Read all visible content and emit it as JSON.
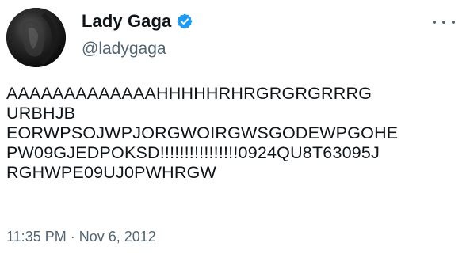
{
  "user": {
    "display_name": "Lady Gaga",
    "handle": "@ladygaga",
    "verified": true
  },
  "tweet": {
    "lines": [
      "AAAAAAAAAAAAAHHHHHRHRGRGRGRRRG",
      "URBHJB",
      "EORWPSOJWPJORGWOIRGWSGODEWPGOHE",
      "PW09GJEDPOKSD!!!!!!!!!!!!!!!!0924QU8T63095J",
      "RGHWPE09UJ0PWHRGW"
    ],
    "timestamp": "11:35 PM · Nov 6, 2012"
  },
  "icons": {
    "verified": "verified-badge-icon",
    "more": "more-options-icon"
  },
  "colors": {
    "accent": "#1d9bf0",
    "text_primary": "#0f1419",
    "text_secondary": "#536471",
    "background": "#ffffff"
  }
}
